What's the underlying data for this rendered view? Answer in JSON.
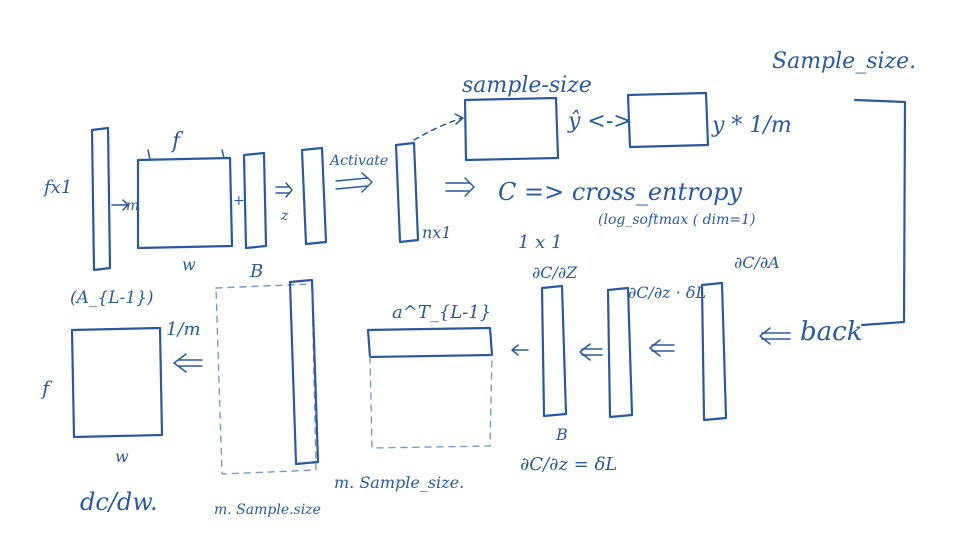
{
  "labels": {
    "sample_size_top_right": "Sample_size.",
    "sample_size_over_box": "sample-size",
    "fx1": "fx1",
    "f_over_w": "f",
    "m_left_w": "m",
    "plus": "+",
    "arrow_z": "z",
    "activate": "Activate",
    "nx1": "nx1",
    "c_eq_cross_entropy": "C => cross_entropy",
    "log_softmax": "(log_softmax ( dim=1)",
    "one_x_one": "1 x 1",
    "y_hat_cmp": "ŷ <->",
    "y_times_one_over_m": "y * 1/m",
    "w_label": "w",
    "b_label": "B",
    "a_l_minus_1": "(A_{L-1})",
    "dc_dz_1": "∂C/∂Z",
    "dc_dz_delta": "∂C/∂z · δL",
    "dc_da": "∂C/∂A",
    "back": "back",
    "one_over_m": "1/m",
    "f_left": "f",
    "w_bottom": "w",
    "dc_dw": "dc/dw.",
    "m_sample_size_bottom": "m. Sample.size",
    "a_l_minus_1_T": "a^T_{L-1}",
    "m_sample_size_mid": "m. Sample_size.",
    "dc_dz_delta_l": "∂C/∂z = δL",
    "b_bottom": "B"
  }
}
